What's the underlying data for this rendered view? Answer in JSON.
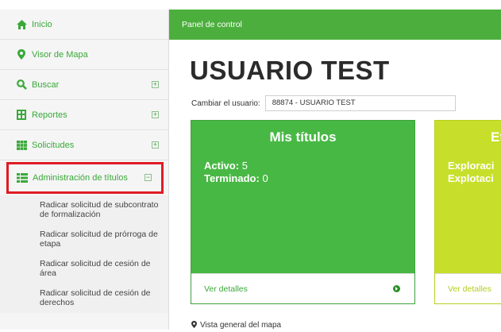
{
  "sidebar": {
    "items": [
      {
        "label": "Inicio",
        "icon": "home-icon",
        "expander": ""
      },
      {
        "label": "Visor de Mapa",
        "icon": "map-marker-icon",
        "expander": ""
      },
      {
        "label": "Buscar",
        "icon": "search-icon",
        "expander": "+"
      },
      {
        "label": "Reportes",
        "icon": "reports-icon",
        "expander": "+"
      },
      {
        "label": "Solicitudes",
        "icon": "grid-icon",
        "expander": "+"
      },
      {
        "label": "Administración de títulos",
        "icon": "list-icon",
        "expander": "−"
      }
    ],
    "submenu": [
      "Radicar solicitud de subcontrato de formalización",
      "Radicar solicitud de prórroga de etapa",
      "Radicar solicitud de cesión de área",
      "Radicar solicitud de cesión de derechos"
    ]
  },
  "header": {
    "title": "Panel de control"
  },
  "page_title": "USUARIO TEST",
  "user": {
    "label": "Cambiar el usuario:",
    "value": "88874 - USUARIO TEST"
  },
  "cards": {
    "titles": {
      "title": "Mis títulos",
      "lines": [
        {
          "key": "Activo:",
          "value": "5"
        },
        {
          "key": "Terminado:",
          "value": "0"
        }
      ],
      "footer": "Ver detalles"
    },
    "stages": {
      "title": "Et",
      "lines": [
        {
          "key": "Exploraci",
          "value": ""
        },
        {
          "key": "Explotaci",
          "value": ""
        }
      ],
      "footer": "Ver detalles"
    }
  },
  "map": {
    "label": "Vista general del mapa"
  },
  "colors": {
    "accent_green": "#4caf3d",
    "card_green": "#48b845",
    "card_lime": "#c7df2a",
    "highlight_red": "#e01b24"
  }
}
